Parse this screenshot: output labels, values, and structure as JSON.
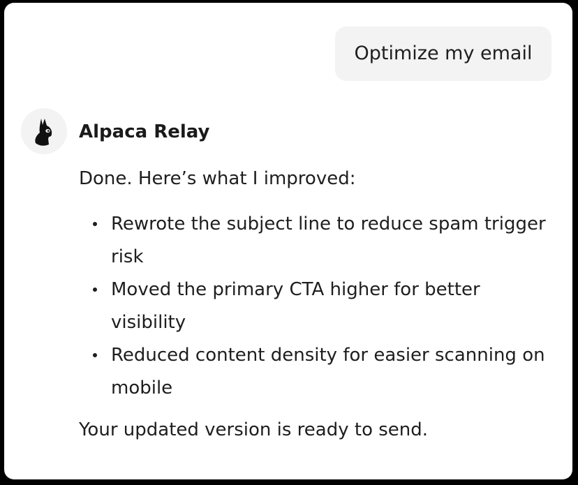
{
  "user_message": {
    "text": "Optimize my email"
  },
  "assistant": {
    "name": "Alpaca Relay",
    "avatar_icon": "alpaca-icon",
    "intro": "Done. Here’s what I improved:",
    "bullets": [
      "Rewrote the subject line to reduce spam trigger risk",
      "Moved the primary CTA higher for better visibility",
      "Reduced content density for easier scanning on mobile"
    ],
    "outro": "Your updated version is ready to send."
  },
  "colors": {
    "frame": "#000000",
    "card": "#ffffff",
    "bubble": "#f3f3f3",
    "text": "#1e1e1e"
  }
}
